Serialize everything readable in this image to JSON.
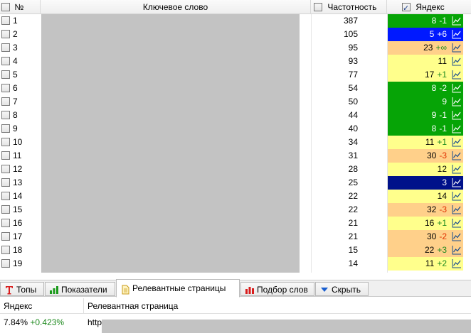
{
  "header": {
    "num_label": "№",
    "keyword_label": "Ключевое слово",
    "freq_label": "Частотность",
    "yandex_label": "Яндекс"
  },
  "rows": [
    {
      "num": "1",
      "freq": "387",
      "pos": "8",
      "delta": "-1",
      "delta_type": "neg",
      "color": "green"
    },
    {
      "num": "2",
      "freq": "105",
      "pos": "5",
      "delta": "+6",
      "delta_type": "pos",
      "color": "blue"
    },
    {
      "num": "3",
      "freq": "95",
      "pos": "23",
      "delta": "+∞",
      "delta_type": "pos",
      "color": "orange"
    },
    {
      "num": "4",
      "freq": "93",
      "pos": "11",
      "delta": "",
      "delta_type": "",
      "color": "yellow"
    },
    {
      "num": "5",
      "freq": "77",
      "pos": "17",
      "delta": "+1",
      "delta_type": "pos",
      "color": "yellow"
    },
    {
      "num": "6",
      "freq": "54",
      "pos": "8",
      "delta": "-2",
      "delta_type": "neg",
      "color": "green"
    },
    {
      "num": "7",
      "freq": "50",
      "pos": "9",
      "delta": "",
      "delta_type": "",
      "color": "green"
    },
    {
      "num": "8",
      "freq": "44",
      "pos": "9",
      "delta": "-1",
      "delta_type": "neg",
      "color": "green"
    },
    {
      "num": "9",
      "freq": "40",
      "pos": "8",
      "delta": "-1",
      "delta_type": "neg",
      "color": "green"
    },
    {
      "num": "10",
      "freq": "34",
      "pos": "11",
      "delta": "+1",
      "delta_type": "pos",
      "color": "yellow"
    },
    {
      "num": "11",
      "freq": "31",
      "pos": "30",
      "delta": "-3",
      "delta_type": "neg",
      "color": "orange"
    },
    {
      "num": "12",
      "freq": "28",
      "pos": "12",
      "delta": "",
      "delta_type": "",
      "color": "yellow"
    },
    {
      "num": "13",
      "freq": "25",
      "pos": "3",
      "delta": "",
      "delta_type": "",
      "color": "navy"
    },
    {
      "num": "14",
      "freq": "22",
      "pos": "14",
      "delta": "",
      "delta_type": "",
      "color": "yellow"
    },
    {
      "num": "15",
      "freq": "22",
      "pos": "32",
      "delta": "-3",
      "delta_type": "neg",
      "color": "orange"
    },
    {
      "num": "16",
      "freq": "21",
      "pos": "16",
      "delta": "+1",
      "delta_type": "pos",
      "color": "yellow"
    },
    {
      "num": "17",
      "freq": "21",
      "pos": "30",
      "delta": "-2",
      "delta_type": "neg",
      "color": "orange"
    },
    {
      "num": "18",
      "freq": "15",
      "pos": "22",
      "delta": "+3",
      "delta_type": "pos",
      "color": "orange"
    },
    {
      "num": "19",
      "freq": "14",
      "pos": "11",
      "delta": "+2",
      "delta_type": "pos",
      "color": "yellow"
    }
  ],
  "tabs": [
    {
      "label": "Топы",
      "icon": "text-t-icon",
      "active": false
    },
    {
      "label": "Показатели",
      "icon": "bar-chart-icon",
      "active": false
    },
    {
      "label": "Релевантные страницы",
      "icon": "document-icon",
      "active": true
    },
    {
      "label": "Подбор слов",
      "icon": "red-bars-icon",
      "active": false
    },
    {
      "label": "Скрыть",
      "icon": "arrow-down-icon",
      "active": false
    }
  ],
  "bottom": {
    "col1_header": "Яндекс",
    "col2_header": "Релевантная страница",
    "row_value": "7.84%",
    "row_delta": "+0.423%",
    "row_page": "http"
  },
  "colors": {
    "green": "#06a406",
    "blue": "#0019ff",
    "navy": "#00118a",
    "yellow": "#ffff8c",
    "orange": "#ffd08a",
    "delta_pos": "#1f8a1f",
    "delta_neg": "#e03000"
  }
}
